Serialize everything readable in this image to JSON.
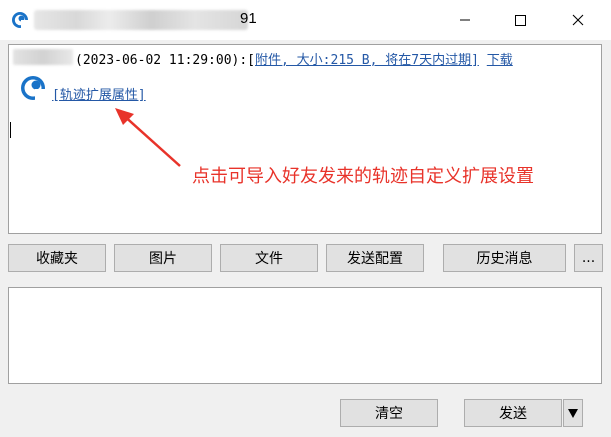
{
  "window": {
    "title_suffix": "91"
  },
  "message": {
    "timestamp": "(2023-06-02 11:29:00):[",
    "attachment_link": "附件, 大小:215 B, 将在7天内过期]",
    "download_link": "下载",
    "track_ext_link": "[轨迹扩展属性]"
  },
  "annotation": {
    "text": "点击可导入好友发来的轨迹自定义扩展设置",
    "color": "#e8332a"
  },
  "toolbar": {
    "favorites": "收藏夹",
    "images": "图片",
    "files": "文件",
    "send_config": "发送配置",
    "history": "历史消息",
    "more": "..."
  },
  "bottom": {
    "clear": "清空",
    "send": "发送"
  },
  "colors": {
    "link": "#2458a6",
    "accent_icon": "#1a73c8"
  }
}
